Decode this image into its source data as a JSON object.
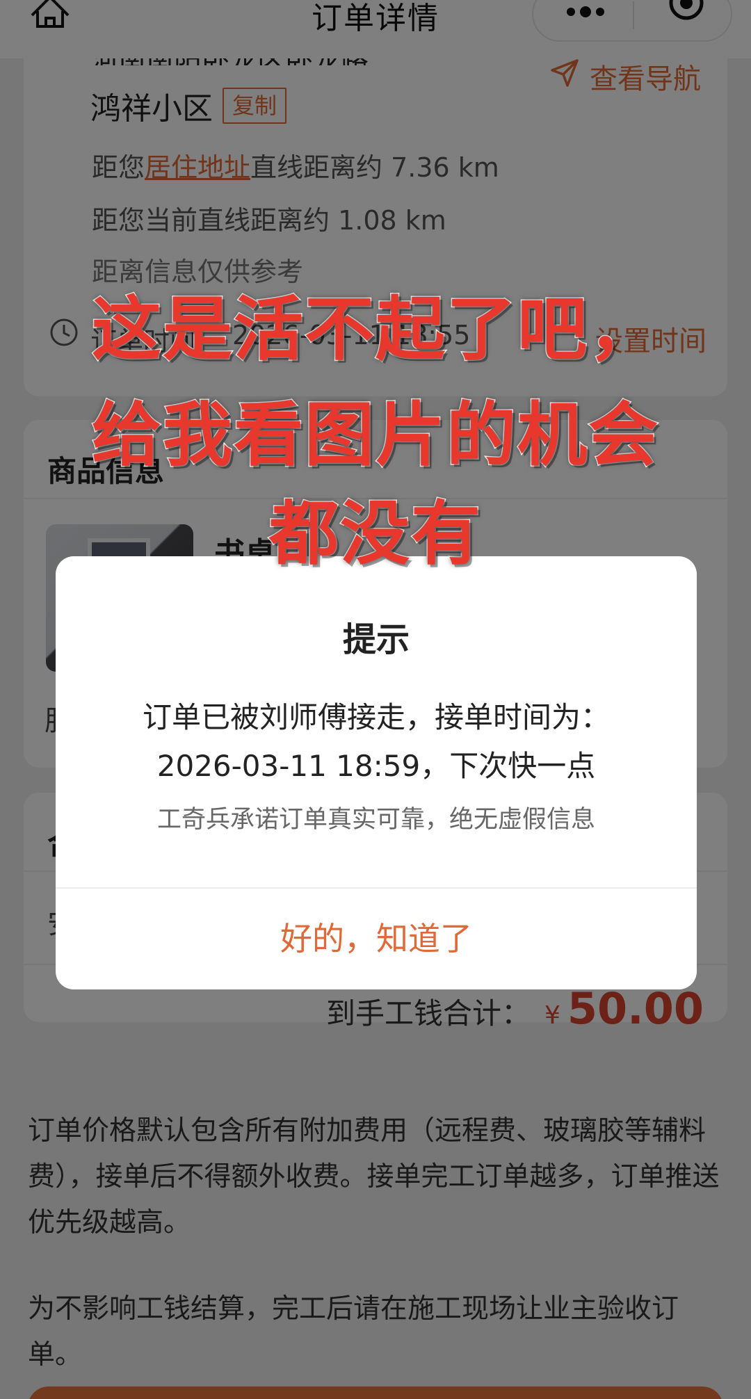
{
  "header": {
    "title": "订单详情",
    "home_icon": "home-icon",
    "more_icon": "more-dots-icon",
    "close_icon": "target-close-icon"
  },
  "address": {
    "partial_line": "河南南阳卧龙区卧龙路",
    "community": "鸿祥小区",
    "copy_label": "复制",
    "nav_label": "查看导航",
    "dist_prefix": "距您",
    "dist_link": "居住地址",
    "dist_suffix": "直线距离约 7.36 km",
    "current_dist": "距您当前直线距离约 1.08 km",
    "dist_note": "距离信息仅供参考",
    "time_label": "订单时间",
    "time_value": "2026-03-11 18:55",
    "set_time_label": "设置时间"
  },
  "goods": {
    "section_title": "商品信息",
    "name": "书桌",
    "foot_text": "服"
  },
  "fees": {
    "section_title": "合",
    "item_label": "安",
    "total_label": "到手工钱合计：",
    "currency": "¥",
    "amount": "50.00"
  },
  "notes": {
    "p1": "订单价格默认包含所有附加费用（远程费、玻璃胶等辅料费），接单后不得额外收费。接单完工订单越多，订单推送优先级越高。",
    "p2": "为不影响工钱结算，完工后请在施工现场让业主验收订单。"
  },
  "modal": {
    "title": "提示",
    "line1": "订单已被刘师傅接走，接单时间为：",
    "line2": "2026-03-11 18:59，下次快一点",
    "line3": "工奇兵承诺订单真实可靠，绝无虚假信息",
    "confirm": "好的，知道了"
  },
  "caption": {
    "line1": "这是活不起了吧，",
    "line2": "给我看图片的机会",
    "line3": "都没有"
  },
  "colors": {
    "accent": "#e06a37",
    "price": "#d9442c",
    "caption": "#e8372c"
  }
}
